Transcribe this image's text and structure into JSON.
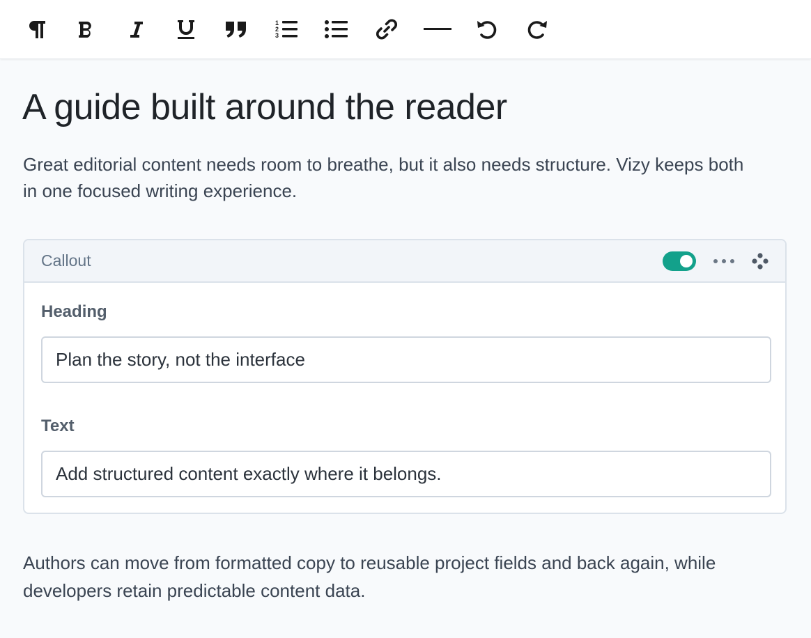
{
  "toolbar": {
    "buttons": [
      {
        "icon": "paragraph-icon"
      },
      {
        "icon": "bold-icon"
      },
      {
        "icon": "italic-icon"
      },
      {
        "icon": "underline-icon"
      },
      {
        "icon": "blockquote-icon"
      },
      {
        "icon": "ordered-list-icon"
      },
      {
        "icon": "bullet-list-icon"
      },
      {
        "icon": "link-icon"
      },
      {
        "icon": "horizontal-rule-icon"
      },
      {
        "icon": "undo-icon"
      },
      {
        "icon": "redo-icon"
      }
    ]
  },
  "document": {
    "title": "A guide built around the reader",
    "lead": "Great editorial content needs room to breathe, but it also needs structure. Vizy keeps both in one focused writing experience.",
    "callout": {
      "title": "Callout",
      "enabled": true,
      "fields": {
        "heading_label": "Heading",
        "heading_value": "Plan the story, not the interface",
        "text_label": "Text",
        "text_value": "Add structured content exactly where it belongs."
      }
    },
    "body": "Authors can move from formatted copy to reusable project fields and back again, while developers retain predictable content data."
  },
  "colors": {
    "toggle_on": "#13a18b",
    "background": "#f8fafc",
    "callout_header": "#f2f5f9"
  }
}
